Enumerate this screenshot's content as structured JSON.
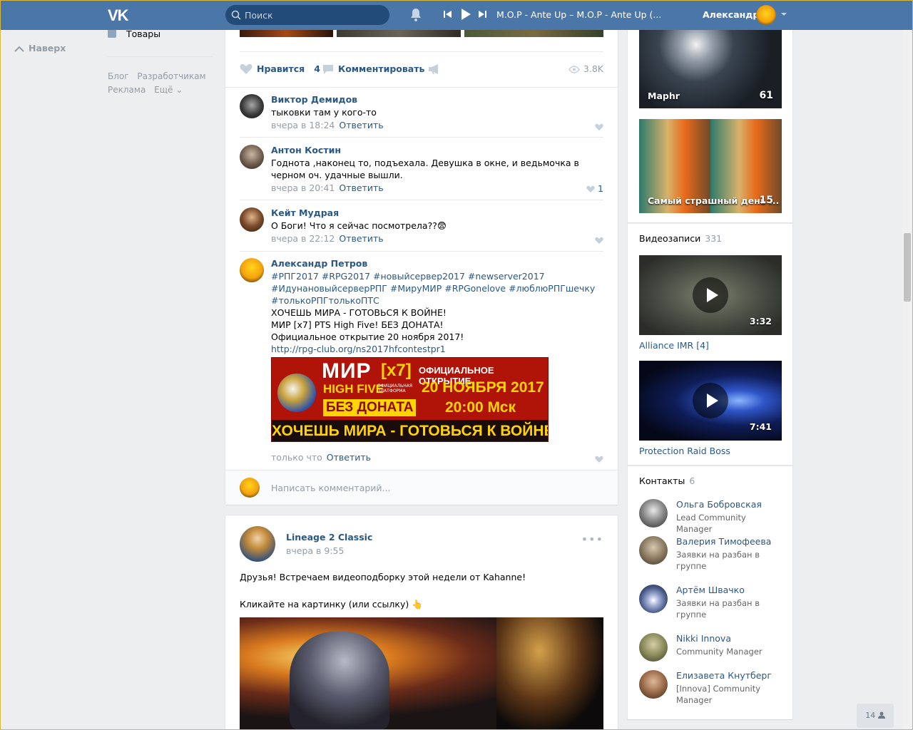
{
  "header": {
    "logo": "VK",
    "search_placeholder": "Поиск",
    "track": "M.O.P - Ante Up – M.O.P - Ante Up (...",
    "user_name": "Александр"
  },
  "left_nav": {
    "up_link": "Наверх",
    "goods": "Товары",
    "footer": [
      "Блог",
      "Разработчикам",
      "Реклама",
      "Ещё ⌄"
    ]
  },
  "post1": {
    "actions": {
      "like_label": "Нравится",
      "like_count": "4",
      "comment_label": "Комментировать",
      "views": "3.8K"
    },
    "comments": [
      {
        "name": "Виктор Демидов",
        "text": "тыковки там у кого-то",
        "time": "вчера в 18:24",
        "reply": "Ответить",
        "likes": ""
      },
      {
        "name": "Антон Костин",
        "text": "Годнота ,наконец то, подъехала. Девушка в окне, и ведьмочка в черном оч. удачные вышли.",
        "time": "вчера в 20:41",
        "reply": "Ответить",
        "likes": "1"
      },
      {
        "name": "Кейт Мудрая",
        "text": "О Боги! Что я сейчас посмотрела??😨",
        "time": "вчера в 22:12",
        "reply": "Ответить",
        "likes": ""
      },
      {
        "name": "Александр Петров",
        "hashtags": "#РПГ2017 #RPG2017 #новыйсервер2017 #newserver2017 #ИдунановыйсерверРПГ #МируМИР #RPGonelove #люблюРПГшечку #толькоРПГтолькоПТС",
        "line1": "ХОЧЕШЬ МИРА - ГОТОВЬСЯ К ВОЙНЕ!",
        "line2": "МИР [x7] PTS High Five! БЕЗ ДОНАТА!",
        "line3": "Официальное открытие 20 ноября 2017!",
        "link": "http://rpg-club.org/ns2017hfcontestpr1",
        "time": "только что",
        "reply": "Ответить"
      }
    ],
    "banner": {
      "mir": "МИР",
      "x7": "[x7]",
      "hf": "HIGH FIVE",
      "plat": "ОФИЦИАЛЬНАЯ ПЛАТФОРМА",
      "no_donate": "БЕЗ ДОНАТА",
      "official": "ОФИЦИАЛЬНОЕ ОТКРЫТИЕ",
      "date": "20 НОЯБРЯ 2017",
      "time": "20:00 Мск",
      "war": "ХОЧЕШЬ МИРА - ГОТОВЬСЯ К ВОЙНЕ"
    },
    "write_placeholder": "Написать комментарий..."
  },
  "post2": {
    "author": "Lineage 2 Classic",
    "date": "вчера в 9:55",
    "dots": "•••",
    "text1": "Друзья! Встречаем видеоподборку этой недели от Kahanne!",
    "text2": "Кликайте на картинку (или ссылку) 👆"
  },
  "right": {
    "albums": [
      {
        "title": "Maphr",
        "count": "61"
      },
      {
        "title": "Самый страшный день ...",
        "count": "15"
      }
    ],
    "videos_label": "Видеозаписи",
    "videos_count": "331",
    "videos": [
      {
        "title": "Alliance IMR [4]",
        "duration": "3:32"
      },
      {
        "title": "Protection Raid Boss",
        "duration": "7:41"
      }
    ],
    "contacts_label": "Контакты",
    "contacts_count": "6",
    "contacts": [
      {
        "name": "Ольга Бобровская",
        "role": "Lead Community Manager"
      },
      {
        "name": "Валерия Тимофеева",
        "role": "Заявки на разбан в группе"
      },
      {
        "name": "Артём Швачко",
        "role": "Заявки на разбан в группе"
      },
      {
        "name": "Nikki Innova",
        "role": "Community Manager"
      },
      {
        "name": "Елизавета Кнутберг",
        "role": "[Innova] Community Manager"
      }
    ]
  },
  "fab_count": "14"
}
